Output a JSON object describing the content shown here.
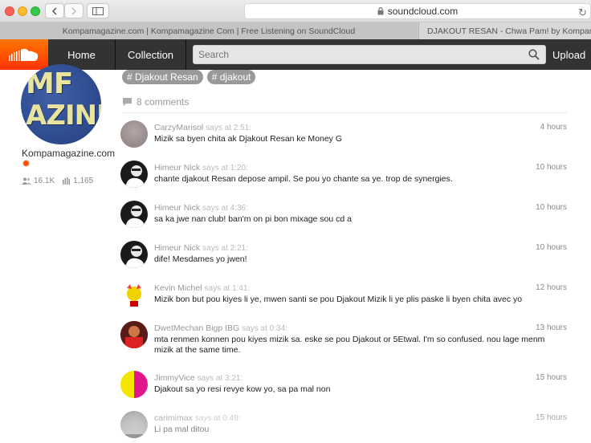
{
  "browser": {
    "url": "soundcloud.com",
    "tabs": [
      {
        "label": "Kompamagazine.com | Kompamagazine Com | Free Listening on SoundCloud"
      },
      {
        "label": "DJAKOUT RESAN - Chwa Pam! by Kompamag"
      }
    ]
  },
  "header": {
    "nav": {
      "home": "Home",
      "collection": "Collection"
    },
    "search_placeholder": "Search",
    "upload": "Upload"
  },
  "profile": {
    "name": "Kompamagazine.com",
    "followers": "16.1K",
    "tracks": "1,165",
    "avatar_text_1": "MF",
    "avatar_text_2": "AZINE"
  },
  "tags": [
    "Djakout Resan",
    "djakout"
  ],
  "comments_count": "8 comments",
  "comments": [
    {
      "user": "CarzyMarisol",
      "says": "says at 2:51:",
      "time": "4 hours",
      "text": "Mizik sa byen chita ak Djakout Resan ke Money G",
      "avatar": "gray"
    },
    {
      "user": "Himeur Nick",
      "says": "says at 1:20:",
      "time": "10 hours",
      "text": "chante djakout Resan depose ampil. Se pou yo chante sa ye. trop de synergies.",
      "avatar": "photo"
    },
    {
      "user": "Himeur Nick",
      "says": "says at 4:36:",
      "time": "10 hours",
      "text": "sa ka jwe nan club! ban'm on pi bon mixage sou cd a",
      "avatar": "photo"
    },
    {
      "user": "Himeur Nick",
      "says": "says at 2:21:",
      "time": "10 hours",
      "text": "dife! Mesdames yo jwen!",
      "avatar": "photo"
    },
    {
      "user": "Kevin Michel",
      "says": "says at 1:41:",
      "time": "12 hours",
      "text": "Mizik bon but pou kiyes li ye, mwen santi se pou Djakout Mizik li ye plis paske li byen chita avec yo",
      "avatar": "kevin"
    },
    {
      "user": "DwetMechan Bigp IBG",
      "says": "says at 0:34:",
      "time": "13 hours",
      "text": "mta renmen konnen pou kiyes mizik sa. eske se pou Djakout or 5Etwal. I'm so confused. nou lage menm mizik at the same time.",
      "avatar": "dwet"
    },
    {
      "user": "JimmyVice",
      "says": "says at 3:21:",
      "time": "15 hours",
      "text": "Djakout sa yo resi revye kow yo, sa pa mal non",
      "avatar": "jimmy"
    },
    {
      "user": "carimimax",
      "says": "says at 0:49:",
      "time": "15 hours",
      "text": "Li pa mal ditou",
      "avatar": "cari"
    }
  ]
}
